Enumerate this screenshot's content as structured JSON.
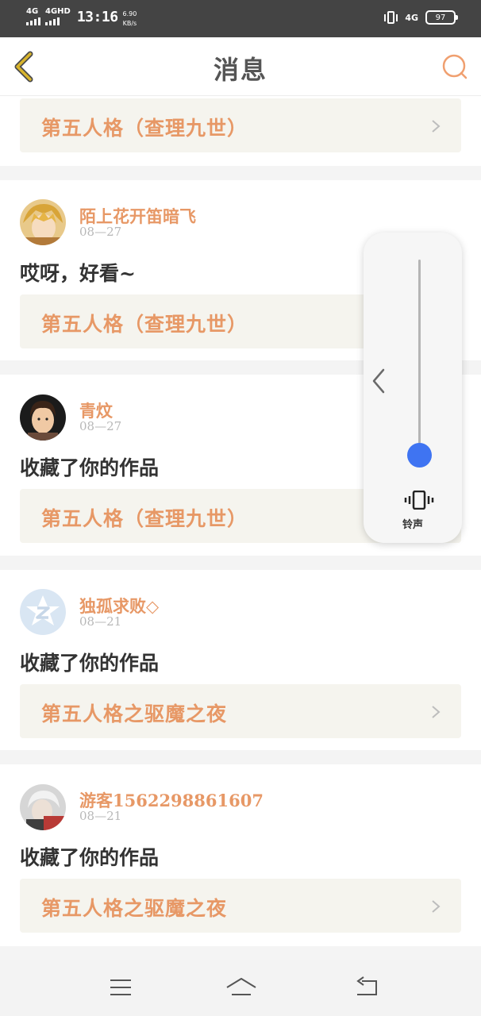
{
  "status_bar": {
    "sim1_network": "4G",
    "sim2_network": "4GHD",
    "time": "13:16",
    "speed_value": "6.90",
    "speed_unit": "KB/s",
    "right_network": "4G",
    "battery": "97"
  },
  "header": {
    "title": "消息",
    "back_icon": "chevron-left-icon",
    "search_icon": "search-icon",
    "accent_color": "#c9a227",
    "search_color": "#f0a070"
  },
  "feed": {
    "top_partial": {
      "work_title": "第五人格（查理九世）"
    },
    "items": [
      {
        "user": "陌上花开笛暗飞",
        "date": "08—27",
        "message": "哎呀，好看~",
        "work_title": "第五人格（查理九世）"
      },
      {
        "user": "青炆",
        "date": "08—27",
        "message": "收藏了你的作品",
        "work_title": "第五人格（查理九世）"
      },
      {
        "user": "独孤求败◇",
        "date": "08—21",
        "message": "收藏了你的作品",
        "work_title": "第五人格之驱魔之夜"
      },
      {
        "user": "游客1562298861607",
        "date": "08—21",
        "message": "收藏了你的作品",
        "work_title": "第五人格之驱魔之夜"
      }
    ]
  },
  "volume_panel": {
    "level": 0.0,
    "mode_icon": "vibrate-icon",
    "mode_label": "铃声",
    "slider_color": "#3f74f2"
  },
  "navbar": {
    "menu_icon": "menu-icon",
    "home_icon": "home-icon",
    "back_icon": "back-arrow-icon"
  },
  "colors": {
    "name": "#e79866",
    "link_bg": "#f5f4ee",
    "text": "#333333"
  }
}
